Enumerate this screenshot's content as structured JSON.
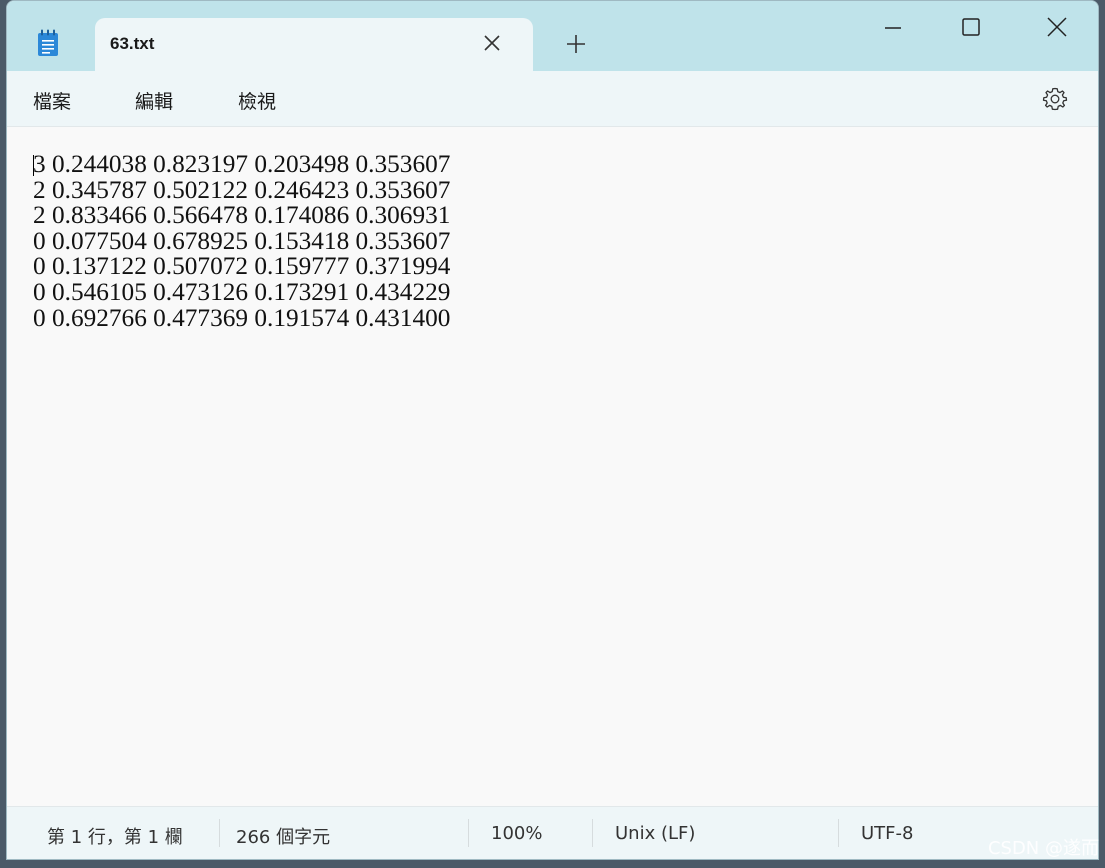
{
  "tab": {
    "title": "63.txt"
  },
  "menu": {
    "items": [
      "檔案",
      "編輯",
      "檢視"
    ]
  },
  "editor": {
    "content": "3 0.244038 0.823197 0.203498 0.353607\n2 0.345787 0.502122 0.246423 0.353607\n2 0.833466 0.566478 0.174086 0.306931\n0 0.077504 0.678925 0.153418 0.353607\n0 0.137122 0.507072 0.159777 0.371994\n0 0.546105 0.473126 0.173291 0.434229\n0 0.692766 0.477369 0.191574 0.431400"
  },
  "status": {
    "position": "第 1 行，第 1 欄",
    "char_count": "266 個字元",
    "zoom": "100%",
    "line_ending": "Unix (LF)",
    "encoding": "UTF-8"
  },
  "watermark": "CSDN @遂而",
  "icons": {
    "app": "notepad-icon",
    "tab_close": "close-icon",
    "new_tab": "plus-icon",
    "minimize": "minimize-icon",
    "maximize": "maximize-icon",
    "close": "close-icon",
    "settings": "gear-icon"
  },
  "colors": {
    "titlebar": "#bfe3ea",
    "tab_bg": "#eef6f8",
    "editor_bg": "#f9f9f9",
    "app_icon": "#2b88d8"
  }
}
